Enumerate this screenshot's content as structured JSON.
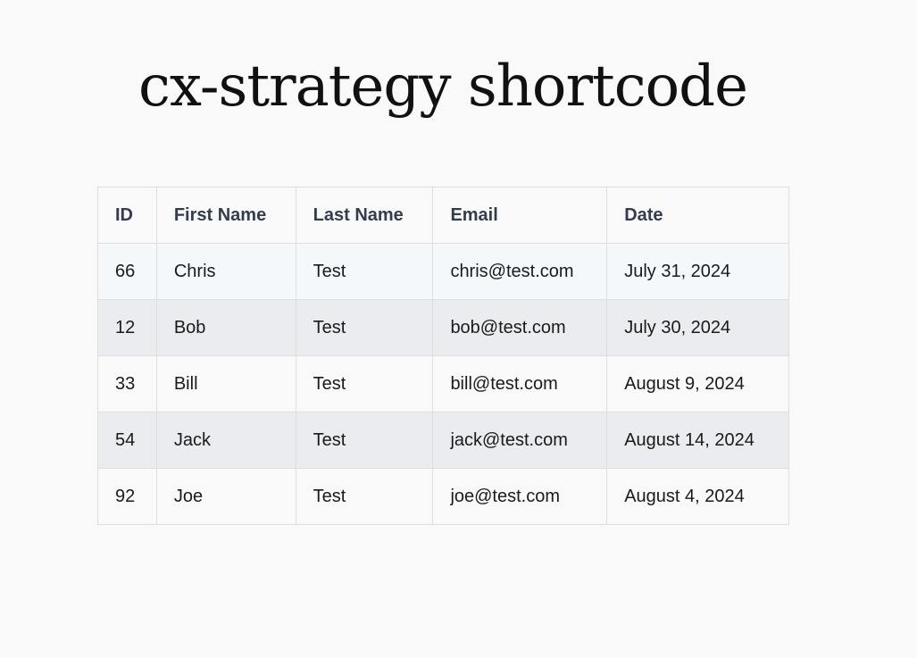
{
  "page": {
    "title": "cx-strategy shortcode"
  },
  "table": {
    "headers": {
      "id": "ID",
      "first_name": "First Name",
      "last_name": "Last Name",
      "email": "Email",
      "date": "Date"
    },
    "rows": [
      {
        "id": "66",
        "first_name": "Chris",
        "last_name": "Test",
        "email": "chris@test.com",
        "date": "July 31, 2024"
      },
      {
        "id": "12",
        "first_name": "Bob",
        "last_name": "Test",
        "email": "bob@test.com",
        "date": "July 30, 2024"
      },
      {
        "id": "33",
        "first_name": "Bill",
        "last_name": "Test",
        "email": "bill@test.com",
        "date": "August 9, 2024"
      },
      {
        "id": "54",
        "first_name": "Jack",
        "last_name": "Test",
        "email": "jack@test.com",
        "date": "August 14, 2024"
      },
      {
        "id": "92",
        "first_name": "Joe",
        "last_name": "Test",
        "email": "joe@test.com",
        "date": "August 4, 2024"
      }
    ]
  },
  "colors": {
    "background": "#f9f9f9",
    "header_text": "#333d4d",
    "row_hover": "#f4f8fb",
    "row_striped": "#ebecef",
    "border": "#dedede"
  }
}
